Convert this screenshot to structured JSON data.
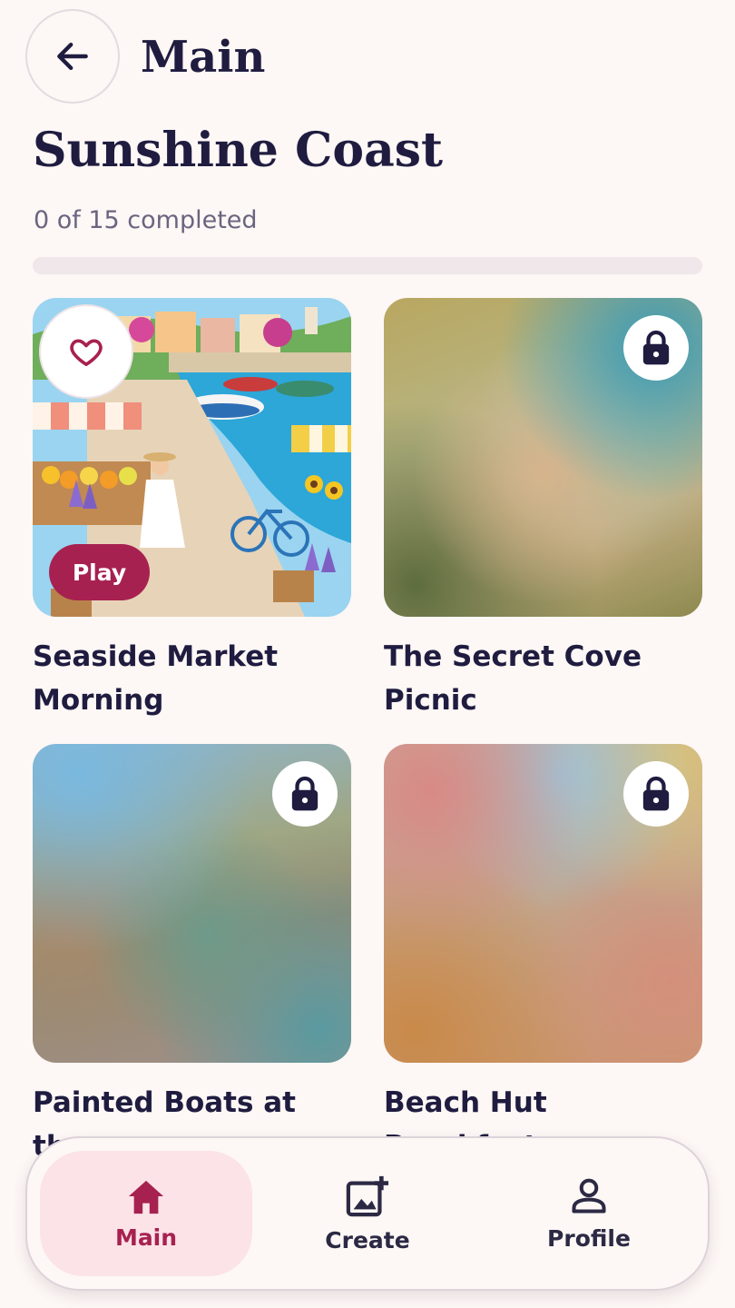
{
  "header": {
    "back_icon": "arrow-left-icon",
    "title": "Main"
  },
  "collection": {
    "title": "Sunshine Coast",
    "progress_text": "0 of 15 completed",
    "progress_fraction": 0
  },
  "cards": [
    {
      "title": "Seaside Market Morning",
      "state": "unlocked",
      "favorite_icon": "heart-outline-icon",
      "play_label": "Play"
    },
    {
      "title": "The Secret Cove Picnic",
      "state": "locked",
      "lock_icon": "lock-icon"
    },
    {
      "title": "Painted Boats at the",
      "state": "locked",
      "lock_icon": "lock-icon"
    },
    {
      "title": "Beach Hut Breakfast",
      "state": "locked",
      "lock_icon": "lock-icon"
    }
  ],
  "bottom_nav": {
    "items": [
      {
        "label": "Main",
        "icon": "home-icon",
        "active": true
      },
      {
        "label": "Create",
        "icon": "add-image-icon",
        "active": false
      },
      {
        "label": "Profile",
        "icon": "person-icon",
        "active": false
      }
    ]
  },
  "colors": {
    "background": "#fdf7f5",
    "text": "#1f1c40",
    "accent": "#a72150",
    "active_nav_bg": "#fbe3e8"
  }
}
